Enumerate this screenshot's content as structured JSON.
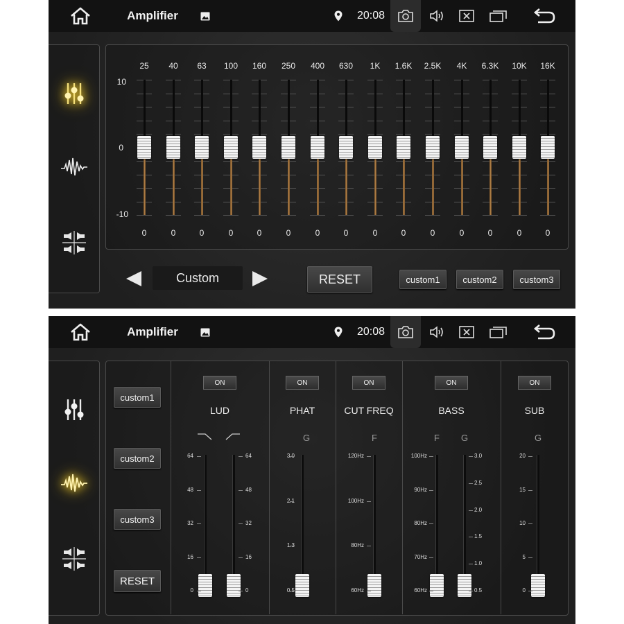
{
  "app": {
    "title": "Amplifier",
    "time": "20:08"
  },
  "colors": {
    "background": "#262626",
    "statusbar": "#121212",
    "accent_glow": "#e8c534",
    "slider_track_lower": "#b8864a"
  },
  "statusbar_icons": [
    "home-icon",
    "gallery-icon",
    "location-pin-icon",
    "camera-icon",
    "volume-icon",
    "close-box-icon",
    "recent-apps-icon",
    "back-icon"
  ],
  "nav": {
    "items": [
      "equalizer-icon",
      "sound-wave-icon",
      "balance-icon"
    ]
  },
  "equalizer": {
    "scale": [
      "10",
      "0",
      "-10"
    ],
    "bands": [
      {
        "freq": "25",
        "value": "0"
      },
      {
        "freq": "40",
        "value": "0"
      },
      {
        "freq": "63",
        "value": "0"
      },
      {
        "freq": "100",
        "value": "0"
      },
      {
        "freq": "160",
        "value": "0"
      },
      {
        "freq": "250",
        "value": "0"
      },
      {
        "freq": "400",
        "value": "0"
      },
      {
        "freq": "630",
        "value": "0"
      },
      {
        "freq": "1K",
        "value": "0"
      },
      {
        "freq": "1.6K",
        "value": "0"
      },
      {
        "freq": "2.5K",
        "value": "0"
      },
      {
        "freq": "4K",
        "value": "0"
      },
      {
        "freq": "6.3K",
        "value": "0"
      },
      {
        "freq": "10K",
        "value": "0"
      },
      {
        "freq": "16K",
        "value": "0"
      }
    ],
    "preset": "Custom",
    "reset_label": "RESET",
    "custom_buttons": [
      "custom1",
      "custom2",
      "custom3"
    ]
  },
  "sound": {
    "side_buttons": [
      "custom1",
      "custom2",
      "custom3"
    ],
    "reset_label": "RESET",
    "on_label": "ON",
    "sections": {
      "lud": {
        "title": "LUD",
        "scale_left": [
          "64",
          "48",
          "32",
          "16",
          "0"
        ],
        "scale_right": [
          "64",
          "48",
          "32",
          "16",
          "0"
        ]
      },
      "phat": {
        "title": "PHAT",
        "sub": "G",
        "scale": [
          "3.0",
          "2.1",
          "1.3",
          "0.5"
        ]
      },
      "cutfreq": {
        "title": "CUT FREQ",
        "sub": "F",
        "scale": [
          "120Hz",
          "100Hz",
          "80Hz",
          "60Hz"
        ]
      },
      "bass": {
        "title": "BASS",
        "sub_f": "F",
        "sub_g": "G",
        "scale_f": [
          "100Hz",
          "90Hz",
          "80Hz",
          "70Hz",
          "60Hz"
        ],
        "scale_g": [
          "3.0",
          "2.5",
          "2.0",
          "1.5",
          "1.0",
          "0.5"
        ]
      },
      "sub": {
        "title": "SUB",
        "sub": "G",
        "scale": [
          "20",
          "15",
          "10",
          "5",
          "0"
        ]
      }
    }
  }
}
